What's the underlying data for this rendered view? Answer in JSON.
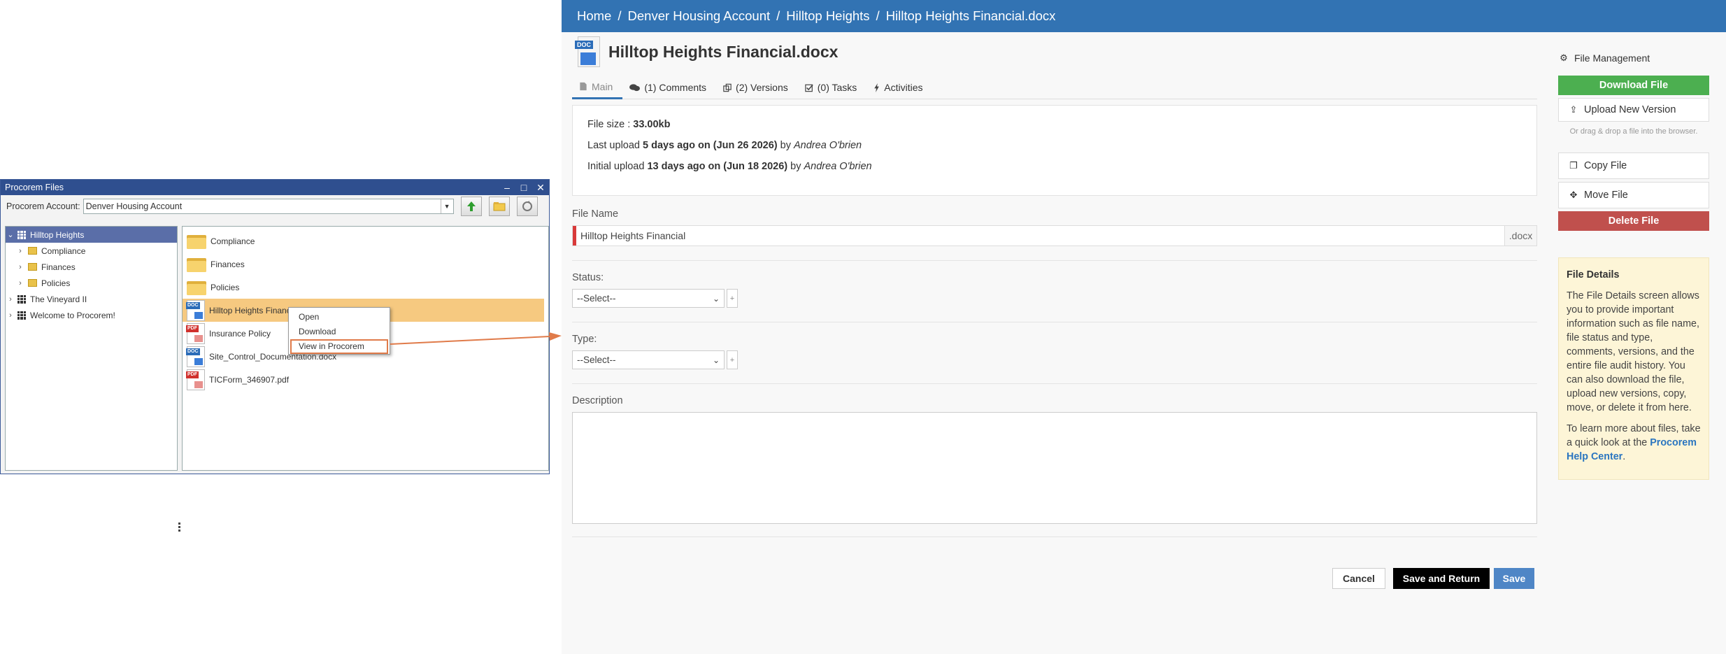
{
  "window": {
    "title": "Procorem Files",
    "controls": {
      "minimize": "–",
      "maximize": "□",
      "close": "✕"
    },
    "account_label": "Procorem Account:",
    "account_value": "Denver Housing Account",
    "tree": [
      {
        "label": "Hilltop Heights",
        "icon": "grid-icon",
        "selected": true,
        "expanded": true
      },
      {
        "label": "Compliance",
        "icon": "folder-icon",
        "indent": 1
      },
      {
        "label": "Finances",
        "icon": "folder-icon",
        "indent": 1
      },
      {
        "label": "Policies",
        "icon": "folder-icon",
        "indent": 1
      },
      {
        "label": "The Vineyard II",
        "icon": "grid-icon"
      },
      {
        "label": "Welcome to Procorem!",
        "icon": "grid-icon"
      }
    ],
    "files": [
      {
        "name": "Compliance",
        "type": "folder"
      },
      {
        "name": "Finances",
        "type": "folder"
      },
      {
        "name": "Policies",
        "type": "folder"
      },
      {
        "name": "Hilltop Heights Financial.docx",
        "type": "word",
        "selected": true
      },
      {
        "name": "Insurance Policy",
        "type": "pdf"
      },
      {
        "name": "Site_Control_Documentation.docx",
        "type": "word"
      },
      {
        "name": "TICForm_346907.pdf",
        "type": "pdf"
      }
    ],
    "context_menu": [
      "Open",
      "Download",
      "View in Procorem"
    ],
    "highlight_color": "#e07b4a"
  },
  "web": {
    "breadcrumb": [
      "Home",
      "Denver Housing Account",
      "Hilltop Heights",
      "Hilltop Heights Financial.docx"
    ],
    "title": "Hilltop Heights Financial.docx",
    "doc_tag": "DOC",
    "tabs": [
      {
        "label": "Main",
        "icon": "file-icon"
      },
      {
        "label": "(1) Comments",
        "icon": "comments-icon"
      },
      {
        "label": "(2) Versions",
        "icon": "versions-icon"
      },
      {
        "label": "(0) Tasks",
        "icon": "tasks-icon"
      },
      {
        "label": "Activities",
        "icon": "bolt-icon"
      }
    ],
    "info": {
      "file_size_label": "File size : ",
      "file_size": "33.00kb",
      "last_upload_label": "Last upload ",
      "last_upload": "5 days ago on (Jun 26 2026)",
      "last_upload_by": "Andrea O'brien",
      "initial_upload_label": "Initial upload ",
      "initial_upload": "13 days ago on (Jun 18 2026)",
      "initial_upload_by": "Andrea O'brien",
      "by": " by "
    },
    "form": {
      "file_name_label": "File Name",
      "file_name_value": "Hilltop Heights Financial",
      "ext": ".docx",
      "status_label": "Status:",
      "status_value": "--Select--",
      "type_label": "Type:",
      "type_value": "--Select--",
      "plus": "+",
      "description_label": "Description"
    },
    "actions": {
      "cancel": "Cancel",
      "save_return": "Save and Return",
      "save": "Save"
    },
    "sidebar": {
      "heading": "File Management",
      "download": "Download File",
      "upload": "Upload New Version",
      "drag_note": "Or drag & drop a file into the browser.",
      "copy": "Copy File",
      "move": "Move File",
      "delete": "Delete File",
      "details_title": "File Details",
      "details_text": "The File Details screen allows you to provide important information such as file name, file status and type, comments, versions, and the entire file audit history. You can also download the file, upload new versions, copy, move, or delete it from here.",
      "learn_text": "To learn more about files, take a quick look at the ",
      "learn_link": "Procorem Help Center",
      "learn_end": "."
    },
    "colors": {
      "header": "#3273b3",
      "download": "#4caf50",
      "delete": "#c0504d",
      "save": "#4f86c6"
    }
  }
}
